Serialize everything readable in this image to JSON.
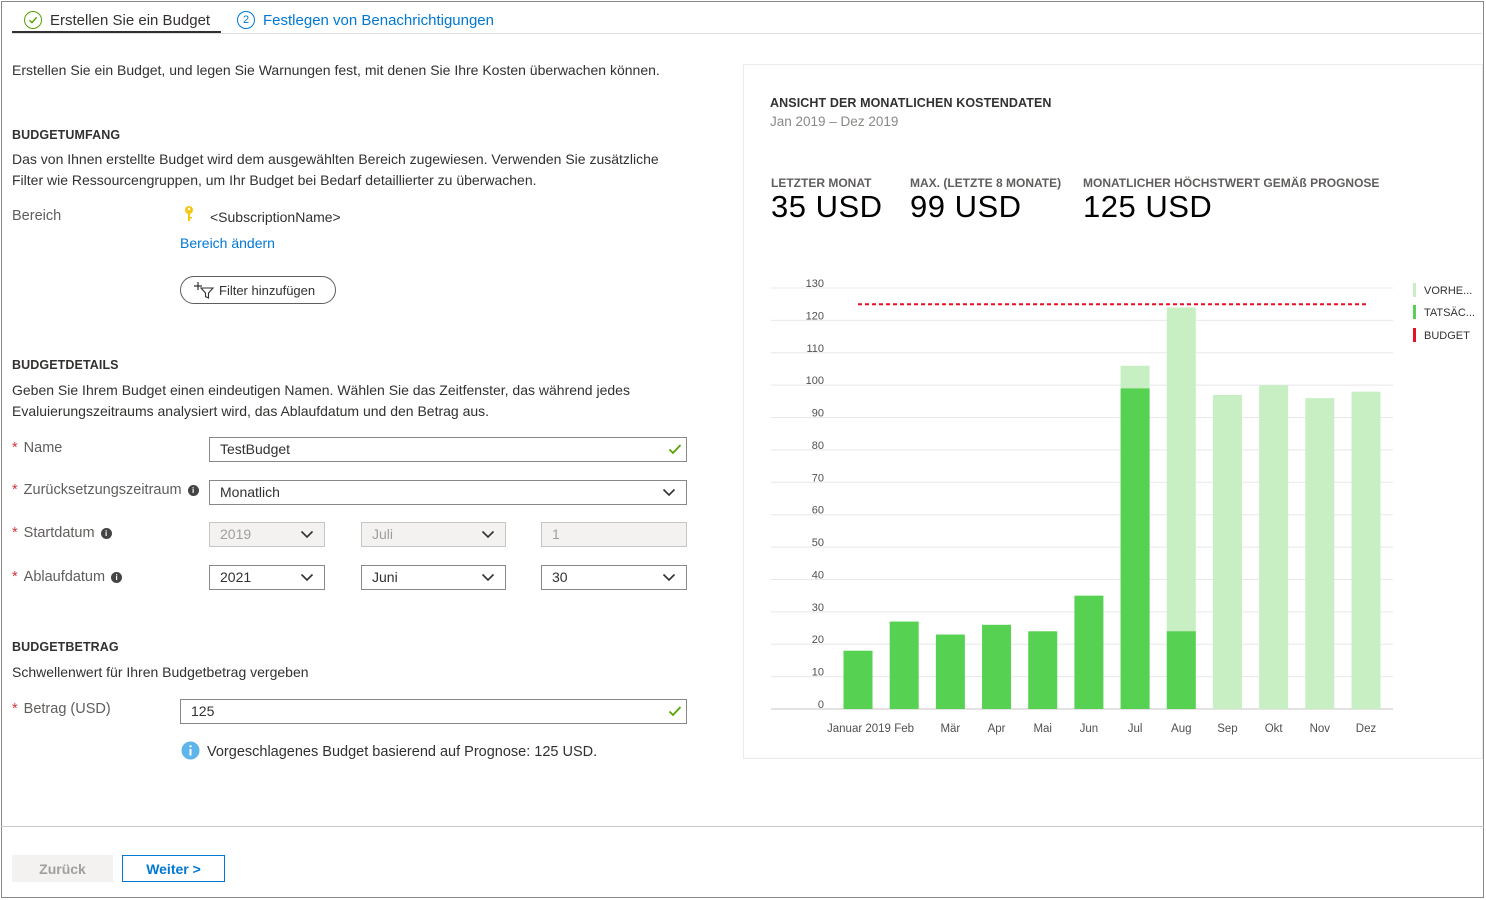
{
  "tabs": [
    {
      "label": "Erstellen Sie ein Budget",
      "status": "done"
    },
    {
      "label": "Festlegen von Benachrichtigungen",
      "number": "2"
    }
  ],
  "intro": "Erstellen Sie ein Budget, und legen Sie Warnungen fest, mit denen Sie Ihre Kosten überwachen können.",
  "scope": {
    "heading": "BUDGETUMFANG",
    "desc_line1": "Das von Ihnen erstellte Budget wird dem ausgewählten Bereich zugewiesen. Verwenden Sie zusätzliche",
    "desc_line2": "Filter wie Ressourcengruppen, um Ihr Budget bei Bedarf detaillierter zu überwachen.",
    "scope_label": "Bereich",
    "scope_value": "<SubscriptionName>",
    "change_link": "Bereich ändern",
    "filter_button": "Filter hinzufügen"
  },
  "details": {
    "heading": "BUDGETDETAILS",
    "desc_line1": "Geben Sie Ihrem Budget einen eindeutigen Namen. Wählen Sie das Zeitfenster, das während jedes",
    "desc_line2": "Evaluierungszeitraums analysiert wird, das Ablaufdatum und den Betrag aus.",
    "required_marker": "*",
    "name_label": "Name",
    "name_value": "TestBudget",
    "reset_label": "Zurücksetzungszeitraum",
    "reset_value": "Monatlich",
    "start_label": "Startdatum",
    "start_year": "2019",
    "start_month": "Juli",
    "start_day": "1",
    "end_label": "Ablaufdatum",
    "end_year": "2021",
    "end_month": "Juni",
    "end_day": "30"
  },
  "amount": {
    "heading": "BUDGETBETRAG",
    "desc": "Schwellenwert für Ihren Budgetbetrag vergeben",
    "label": "Betrag (USD)",
    "value": "125",
    "hint": "Vorgeschlagenes Budget basierend auf Prognose: 125 USD."
  },
  "chart_panel": {
    "title": "ANSICHT DER MONATLICHEN KOSTENDATEN",
    "range": "Jan 2019 – Dez 2019",
    "stats": [
      {
        "label": "LETZTER MONAT",
        "value": "35 USD"
      },
      {
        "label": "MAX. (LETZTE 8 MONATE)",
        "value": "99 USD"
      },
      {
        "label": "MONATLICHER HÖCHSTWERT GEMÄß PROGNOSE",
        "value": "125 USD"
      }
    ]
  },
  "chart_data": {
    "type": "bar",
    "categories": [
      "Januar 2019",
      "Feb",
      "Mär",
      "Apr",
      "Mai",
      "Jun",
      "Jul",
      "Aug",
      "Sep",
      "Okt",
      "Nov",
      "Dez"
    ],
    "series": [
      {
        "name": "VORHE...",
        "values": [
          null,
          null,
          null,
          null,
          null,
          null,
          106,
          124,
          97,
          100,
          96,
          98
        ],
        "color": "#c8efc4"
      },
      {
        "name": "TATSÄC...",
        "values": [
          18,
          27,
          23,
          26,
          24,
          35,
          99,
          24,
          null,
          null,
          null,
          null
        ],
        "color": "#57d152"
      },
      {
        "name": "BUDGET",
        "values": [
          125,
          125,
          125,
          125,
          125,
          125,
          125,
          125,
          125,
          125,
          125,
          125
        ],
        "color": "#e81123"
      }
    ],
    "ylim": [
      0,
      130
    ],
    "yticks": [
      "0",
      "10",
      "20",
      "30",
      "40",
      "50",
      "60",
      "70",
      "80",
      "90",
      "100",
      "110",
      "120",
      "130"
    ],
    "legend": "right",
    "grid": true
  },
  "footer": {
    "back": "Zurück",
    "next": "Weiter >"
  }
}
